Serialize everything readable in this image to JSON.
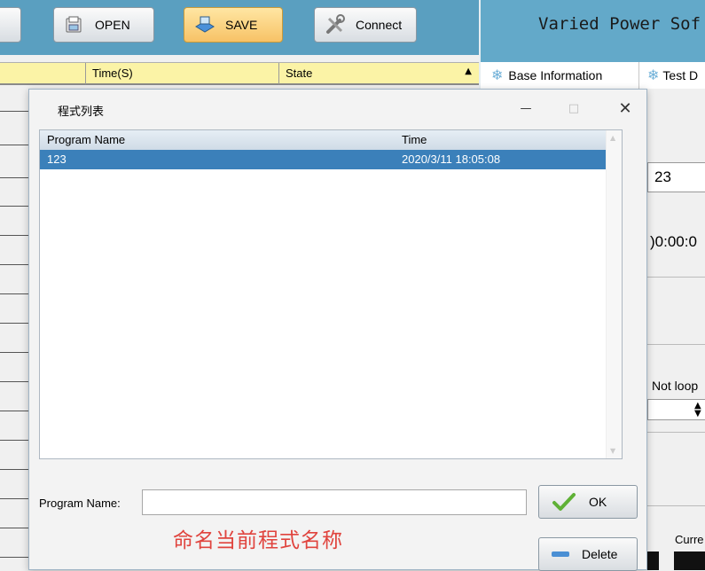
{
  "toolbar": {
    "open_label": "OPEN",
    "save_label": "SAVE",
    "connect_label": "Connect"
  },
  "app": {
    "title": "Varied Power Sof"
  },
  "table": {
    "headers": [
      "Time(S)",
      "State"
    ]
  },
  "right_panel": {
    "tabs": [
      "Base Information",
      "Test D"
    ],
    "value1": "23",
    "time_value": ")0:00:0",
    "loop_label": "Not loop",
    "bottom_label": "Curre"
  },
  "dialog": {
    "title": "程式列表",
    "columns": [
      "Program Name",
      "Time"
    ],
    "rows": [
      {
        "name": "123",
        "time": "2020/3/11 18:05:08"
      }
    ],
    "program_name_label": "Program Name:",
    "program_name_value": "",
    "hint": "命名当前程式名称",
    "ok_label": "OK",
    "delete_label": "Delete"
  },
  "colors": {
    "toolbar": "#5a9fc0",
    "header_yellow": "#fbf3a6",
    "selection": "#3b80ba",
    "hint_red": "#e0443e"
  }
}
